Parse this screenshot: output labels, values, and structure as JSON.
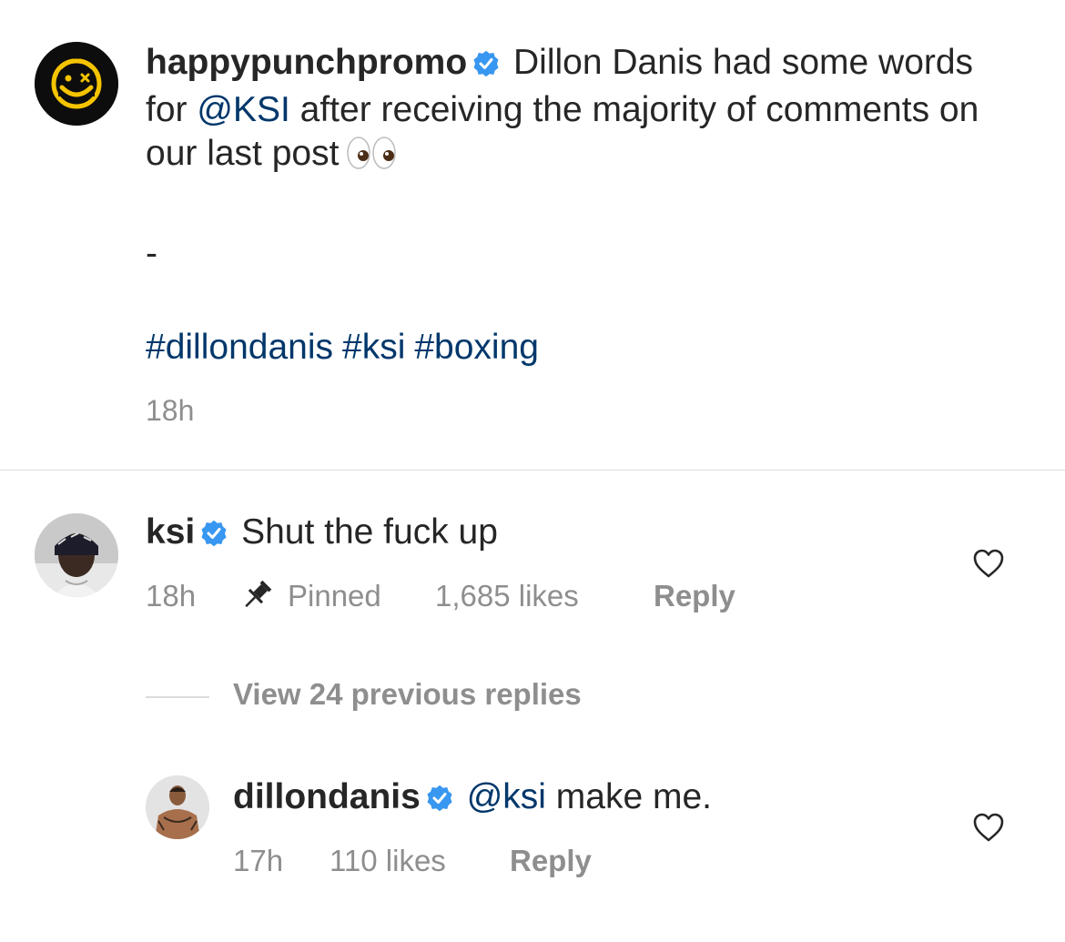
{
  "post": {
    "username": "happypunchpromo",
    "caption_text": "Dillon Danis had some words for",
    "mention": "@KSI",
    "caption_rest": "after receiving the majority of comments on our last post",
    "emoji_name": "eyes-emoji",
    "dash": "-",
    "hashtags": [
      "#dillondanis",
      "#ksi",
      "#boxing"
    ],
    "time": "18h"
  },
  "comments": [
    {
      "username": "ksi",
      "text": "Shut the fuck up",
      "time": "18h",
      "pinned_label": "Pinned",
      "likes": "1,685 likes",
      "reply_label": "Reply"
    },
    {
      "username": "dillondanis",
      "mention": "@ksi",
      "text": "make me.",
      "time": "17h",
      "likes": "110 likes",
      "reply_label": "Reply"
    }
  ],
  "view_replies_label": "View 24 previous replies",
  "colors": {
    "text": "#262626",
    "secondary": "#8e8e8e",
    "link": "#00376b",
    "verified": "#3897f0",
    "logo_yellow": "#f5c400"
  }
}
